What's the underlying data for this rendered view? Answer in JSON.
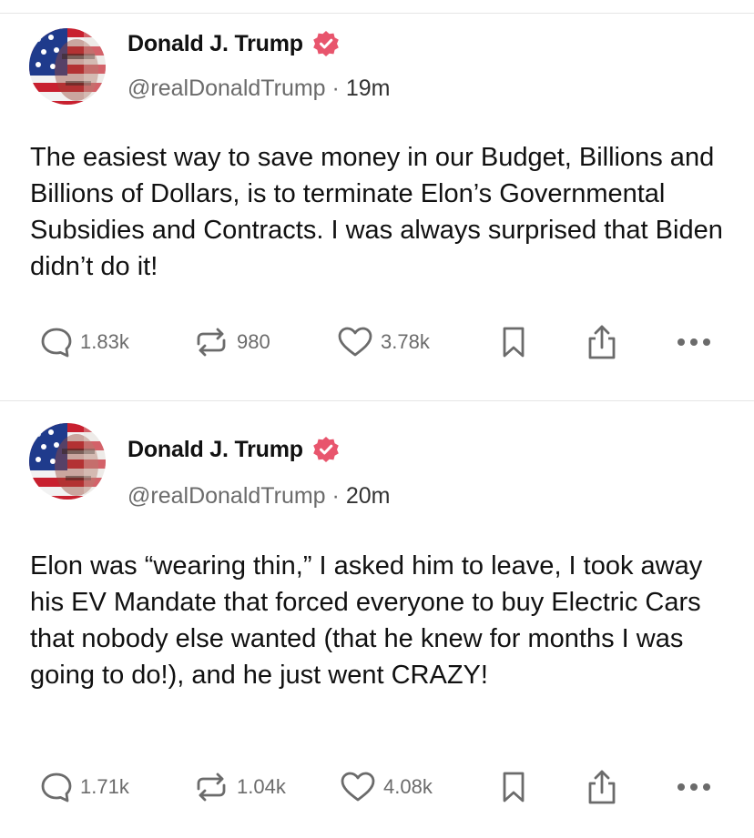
{
  "posts": [
    {
      "display_name": "Donald J. Trump",
      "handle": "@realDonaldTrump",
      "separator": "·",
      "timestamp": "19m",
      "text": "The easiest way to save money in our Budget, Billions and Billions of Dollars, is to terminate Elon’s Governmental Subsidies and Contracts. I was always surprised that Biden didn’t do it!",
      "replies": "1.83k",
      "reposts": "980",
      "likes": "3.78k"
    },
    {
      "display_name": "Donald J. Trump",
      "handle": "@realDonaldTrump",
      "separator": "·",
      "timestamp": "20m",
      "text": "Elon was “wearing thin,” I asked him to leave, I took away his EV Mandate that forced everyone to buy Electric Cars that nobody else wanted (that he knew for months I was going to do!), and he just went CRAZY!",
      "replies": "1.71k",
      "reposts": "1.04k",
      "likes": "4.08k"
    }
  ],
  "icons": {
    "avatar": "flag-portrait-avatar",
    "verified": "verified-badge-icon",
    "reply": "speech-bubble-icon",
    "repost": "repost-arrows-icon",
    "like": "heart-icon",
    "bookmark": "bookmark-icon",
    "share": "share-upload-icon",
    "more": "more-dots-icon"
  },
  "colors": {
    "verified_badge": "#e8556d",
    "text": "#111111",
    "muted": "#6b6b6b",
    "divider": "#e6e6e6"
  }
}
